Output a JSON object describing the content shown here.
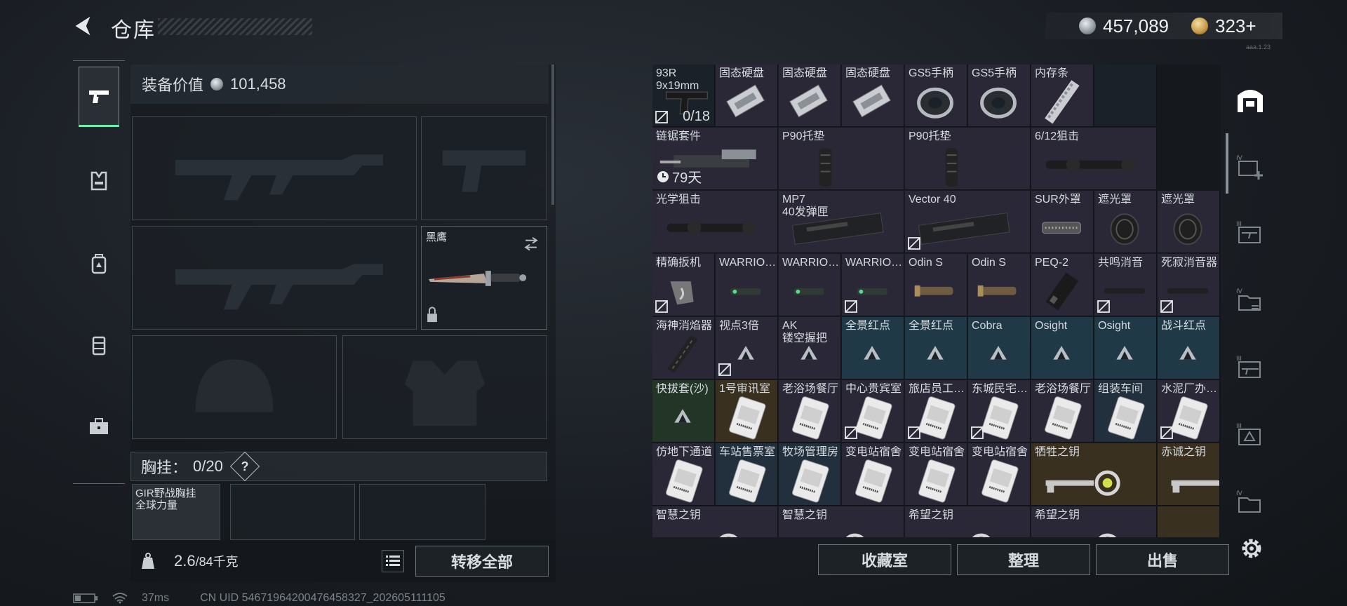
{
  "header": {
    "title": "仓库",
    "silver": "457,089",
    "gold": "323+",
    "version": "aaa.1.23"
  },
  "loadout": {
    "equip_label": "装备价值",
    "equip_value": "101,458",
    "melee_name": "黑鹰",
    "chest_label": "胸挂：",
    "chest_count": "0/20",
    "chest_help": "?",
    "vest_name": "GIR野战胸挂\n全球力量",
    "weight_value": "2.6",
    "weight_max": "/84千克",
    "transfer_label": "转移全部"
  },
  "status": {
    "ping": "37ms",
    "uid": "CN UID 5467196420047645832​7_202605111105"
  },
  "grid": {
    "rows": [
      [
        {
          "n": "93R\n9x19mm",
          "bg": "c-empty",
          "icon": "pistol-icon",
          "flag": true,
          "count": "0/18"
        },
        {
          "n": "固态硬盘",
          "bg": "c-purple",
          "icon": "ssd-icon"
        },
        {
          "n": "固态硬盘",
          "bg": "c-purple",
          "icon": "ssd-icon"
        },
        {
          "n": "固态硬盘",
          "bg": "c-purple",
          "icon": "ssd-icon"
        },
        {
          "n": "GS5手柄",
          "bg": "c-purple",
          "icon": "grip-icon"
        },
        {
          "n": "GS5手柄",
          "bg": "c-purple",
          "icon": "grip-icon"
        },
        {
          "n": "内存条",
          "bg": "c-purple",
          "icon": "ram-icon"
        },
        {
          "n": "",
          "bg": "c-empty",
          "icon": ""
        }
      ],
      [
        {
          "n": "链锯套件",
          "bg": "c-purple",
          "icon": "chainsaw-icon",
          "wide": 2,
          "timer": "79天"
        },
        {
          "n": "P90托垫",
          "bg": "c-purple",
          "icon": "stock-icon",
          "wide": 2
        },
        {
          "n": "P90托垫",
          "bg": "c-purple",
          "icon": "stock-icon",
          "wide": 2
        },
        {
          "n": "6/12狙击",
          "bg": "c-purple",
          "icon": "scope-icon",
          "wide": 2
        }
      ],
      [
        {
          "n": "光学狙击",
          "bg": "c-purple",
          "icon": "scope-icon",
          "wide": 2
        },
        {
          "n": "MP7\n40发弹匣",
          "bg": "c-purple",
          "icon": "magazine-icon",
          "wide": 2
        },
        {
          "n": "Vector 40",
          "bg": "c-purple",
          "icon": "magazine-icon",
          "wide": 2,
          "flag": true
        },
        {
          "n": "SUR外罩",
          "bg": "c-purple",
          "icon": "cover-icon"
        },
        {
          "n": "遮光罩",
          "bg": "c-purple",
          "icon": "hood-icon"
        },
        {
          "n": "遮光罩",
          "bg": "c-purple",
          "icon": "hood-icon"
        }
      ],
      [
        {
          "n": "精确扳机",
          "bg": "c-purple",
          "icon": "trigger-icon",
          "flag": true
        },
        {
          "n": "WARRIO…",
          "bg": "c-purple",
          "icon": "laser-icon"
        },
        {
          "n": "WARRIO…",
          "bg": "c-purple",
          "icon": "laser-icon"
        },
        {
          "n": "WARRIO…",
          "bg": "c-purple",
          "icon": "laser-icon",
          "flag": true
        },
        {
          "n": "Odin S",
          "bg": "c-purple",
          "icon": "light-icon"
        },
        {
          "n": "Odin S",
          "bg": "c-purple",
          "icon": "light-icon"
        },
        {
          "n": "PEQ-2",
          "bg": "c-purple",
          "icon": "peq-icon"
        },
        {
          "n": "共鸣消音",
          "bg": "c-purple",
          "icon": "suppressor-icon",
          "flag": true
        },
        {
          "n": "死寂消音器",
          "bg": "c-purple",
          "icon": "suppressor-icon",
          "flag": true
        }
      ],
      [
        {
          "n": "海神消焰器",
          "bg": "c-purple",
          "icon": "flash-icon"
        },
        {
          "n": "视点3倍",
          "bg": "c-purple",
          "icon": "triangle-icon",
          "flag": true
        },
        {
          "n": "AK\n镂空握把",
          "bg": "c-purple",
          "icon": "triangle-icon"
        },
        {
          "n": "全景红点",
          "bg": "c-teal",
          "icon": "triangle-icon"
        },
        {
          "n": "全景红点",
          "bg": "c-teal",
          "icon": "triangle-icon"
        },
        {
          "n": "Cobra",
          "bg": "c-teal",
          "icon": "triangle-icon"
        },
        {
          "n": "Osight",
          "bg": "c-teal",
          "icon": "triangle-icon"
        },
        {
          "n": "Osight",
          "bg": "c-teal",
          "icon": "triangle-icon"
        },
        {
          "n": "战斗红点",
          "bg": "c-teal",
          "icon": "triangle-icon"
        }
      ],
      [
        {
          "n": "快拔套(沙)",
          "bg": "c-green",
          "icon": "triangle-icon"
        },
        {
          "n": "1号审讯室",
          "bg": "c-gold",
          "icon": "card-icon"
        },
        {
          "n": "老浴场餐厅",
          "bg": "c-purple",
          "icon": "card-icon"
        },
        {
          "n": "中心贵宾室",
          "bg": "c-purple",
          "icon": "card-icon",
          "flag": true
        },
        {
          "n": "旅店员工…",
          "bg": "c-purple",
          "icon": "card-icon",
          "flag": true
        },
        {
          "n": "东城民宅…",
          "bg": "c-purple",
          "icon": "card-icon",
          "flag": true
        },
        {
          "n": "老浴场餐厅",
          "bg": "c-purple",
          "icon": "card-icon"
        },
        {
          "n": "组装车间",
          "bg": "c-blue",
          "icon": "card-icon"
        },
        {
          "n": "水泥厂办…",
          "bg": "c-purple",
          "icon": "card-icon",
          "flag": true
        }
      ],
      [
        {
          "n": "仿地下通道",
          "bg": "c-purple",
          "icon": "card-icon"
        },
        {
          "n": "车站售票室",
          "bg": "c-blue",
          "icon": "card-icon"
        },
        {
          "n": "牧场管理房",
          "bg": "c-blue",
          "icon": "card-icon"
        },
        {
          "n": "变电站宿舍",
          "bg": "c-purple",
          "icon": "card-icon"
        },
        {
          "n": "变电站宿舍",
          "bg": "c-purple",
          "icon": "card-icon"
        },
        {
          "n": "变电站宿舍",
          "bg": "c-purple",
          "icon": "card-icon"
        },
        {
          "n": "牺牲之钥",
          "bg": "c-gold",
          "icon": "key-icon",
          "wide": 2
        },
        {
          "n": "赤诚之钥",
          "bg": "c-gold",
          "icon": "key-icon"
        }
      ],
      [
        {
          "n": "智慧之钥",
          "bg": "c-purple",
          "icon": "key-icon",
          "wide": 2
        },
        {
          "n": "智慧之钥",
          "bg": "c-purple",
          "icon": "key-icon",
          "wide": 2
        },
        {
          "n": "希望之钥",
          "bg": "c-purple",
          "icon": "key-icon",
          "wide": 2
        },
        {
          "n": "希望之钥",
          "bg": "c-purple",
          "icon": "key-icon",
          "wide": 2
        },
        {
          "n": "",
          "bg": "c-gold",
          "icon": ""
        }
      ]
    ]
  },
  "buttons": {
    "collection": "收藏室",
    "sort": "整理",
    "sell": "出售"
  }
}
